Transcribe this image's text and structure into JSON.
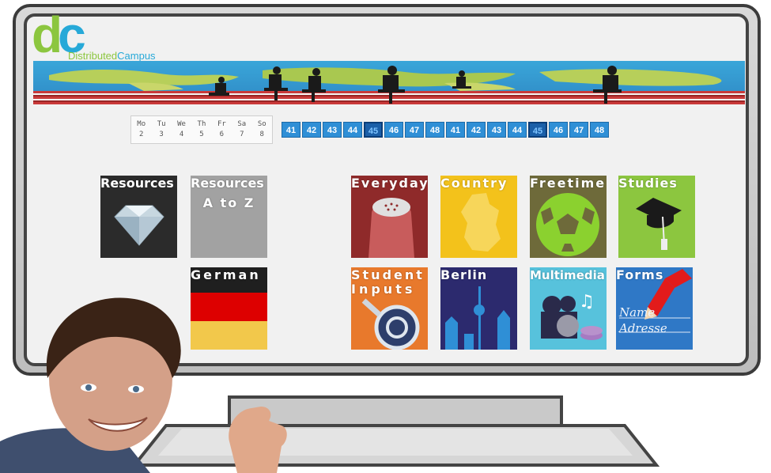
{
  "logo": {
    "mark": "dc",
    "mark_c": "c",
    "text_part1": "Distributed",
    "text_part2": "Campus"
  },
  "calendar": {
    "weekdays": [
      {
        "day": "Mo",
        "date": "2"
      },
      {
        "day": "Tu",
        "date": "3"
      },
      {
        "day": "We",
        "date": "4"
      },
      {
        "day": "Th",
        "date": "5"
      },
      {
        "day": "Fr",
        "date": "6"
      },
      {
        "day": "Sa",
        "date": "7"
      },
      {
        "day": "So",
        "date": "8"
      }
    ],
    "weeks": [
      "41",
      "42",
      "43",
      "44",
      "45",
      "46",
      "47",
      "48",
      "41",
      "42",
      "43",
      "44",
      "45",
      "46",
      "47",
      "48"
    ],
    "current_week": "45"
  },
  "tiles": {
    "resources": "Resources",
    "resources_az_1": "Resources",
    "resources_az_2": "A to Z",
    "german": "German",
    "everyday": "Everyday",
    "country": "Country",
    "freetime": "Freetime",
    "studies": "Studies",
    "student_inputs_1": "Student",
    "student_inputs_2": "Inputs",
    "berlin": "Berlin",
    "multimedia": "Multimedia",
    "forms": "Forms",
    "forms_name": "Name",
    "forms_adresse": "Adresse"
  },
  "colors": {
    "brand_green": "#8cc63f",
    "brand_blue": "#27a9d8",
    "week_blue": "#2f8fd6"
  }
}
